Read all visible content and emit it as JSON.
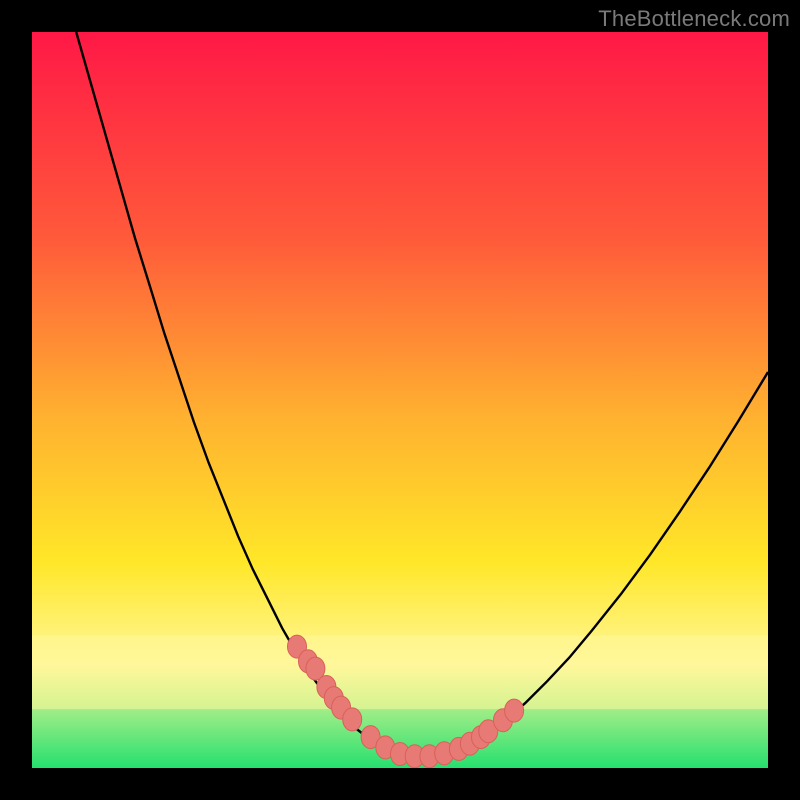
{
  "watermark": "TheBottleneck.com",
  "colors": {
    "background": "#000000",
    "gradient_top": "#ff1846",
    "gradient_mid1": "#ff5a3a",
    "gradient_mid2": "#ffb030",
    "gradient_mid3": "#ffe728",
    "gradient_mid4": "#fff79a",
    "gradient_bottom": "#25e06f",
    "curve": "#000000",
    "dot_fill": "#e77a74",
    "dot_stroke": "#d9605a"
  },
  "chart_data": {
    "type": "line",
    "title": "",
    "xlabel": "",
    "ylabel": "",
    "xlim": [
      0,
      100
    ],
    "ylim": [
      0,
      100
    ],
    "curve": {
      "x": [
        6,
        8,
        10,
        12,
        14,
        16,
        18,
        20,
        22,
        24,
        26,
        28,
        30,
        32,
        34,
        36,
        38,
        40,
        42,
        44,
        46,
        48,
        50,
        52,
        55,
        58,
        61,
        64,
        67,
        70,
        73,
        76,
        80,
        84,
        88,
        92,
        96,
        100
      ],
      "y": [
        100,
        93,
        86,
        79,
        72,
        65.5,
        59,
        53,
        47,
        41.5,
        36.5,
        31.5,
        27,
        23,
        19,
        15.5,
        12.5,
        9.8,
        7.4,
        5.4,
        3.8,
        2.6,
        1.8,
        1.5,
        1.6,
        2.4,
        4.0,
        6.2,
        8.8,
        11.8,
        15.0,
        18.6,
        23.6,
        29.0,
        34.8,
        40.8,
        47.2,
        53.8
      ]
    },
    "dots": {
      "x": [
        36,
        37.5,
        38.5,
        40,
        41,
        42,
        43.5,
        46,
        48,
        50,
        52,
        54,
        56,
        58,
        59.5,
        61,
        62,
        64,
        65.5
      ],
      "y": [
        16.5,
        14.5,
        13.5,
        11,
        9.5,
        8.2,
        6.6,
        4.2,
        2.8,
        1.9,
        1.6,
        1.6,
        2.0,
        2.6,
        3.3,
        4.2,
        5.0,
        6.5,
        7.8
      ]
    }
  }
}
